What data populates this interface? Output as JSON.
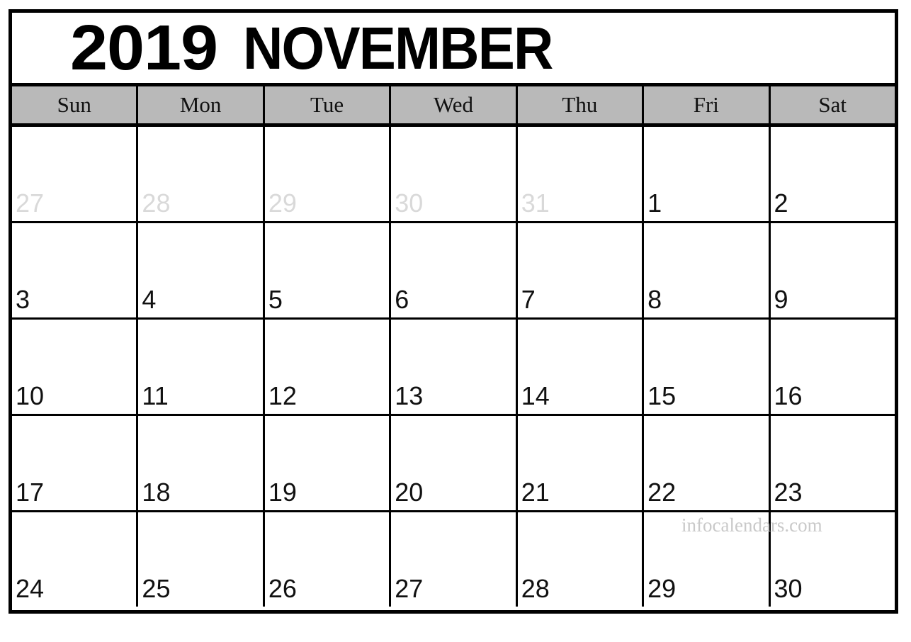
{
  "calendar": {
    "year": "2019",
    "month": "NOVEMBER",
    "weekdays": [
      {
        "label": "Sun"
      },
      {
        "label": "Mon"
      },
      {
        "label": "Tue"
      },
      {
        "label": "Wed"
      },
      {
        "label": "Thu"
      },
      {
        "label": "Fri"
      },
      {
        "label": "Sat"
      }
    ],
    "weeks": [
      [
        {
          "day": "27",
          "muted": true
        },
        {
          "day": "28",
          "muted": true
        },
        {
          "day": "29",
          "muted": true
        },
        {
          "day": "30",
          "muted": true
        },
        {
          "day": "31",
          "muted": true
        },
        {
          "day": "1",
          "muted": false
        },
        {
          "day": "2",
          "muted": false
        }
      ],
      [
        {
          "day": "3",
          "muted": false
        },
        {
          "day": "4",
          "muted": false
        },
        {
          "day": "5",
          "muted": false
        },
        {
          "day": "6",
          "muted": false
        },
        {
          "day": "7",
          "muted": false
        },
        {
          "day": "8",
          "muted": false
        },
        {
          "day": "9",
          "muted": false
        }
      ],
      [
        {
          "day": "10",
          "muted": false
        },
        {
          "day": "11",
          "muted": false
        },
        {
          "day": "12",
          "muted": false
        },
        {
          "day": "13",
          "muted": false
        },
        {
          "day": "14",
          "muted": false
        },
        {
          "day": "15",
          "muted": false
        },
        {
          "day": "16",
          "muted": false
        }
      ],
      [
        {
          "day": "17",
          "muted": false
        },
        {
          "day": "18",
          "muted": false
        },
        {
          "day": "19",
          "muted": false
        },
        {
          "day": "20",
          "muted": false
        },
        {
          "day": "21",
          "muted": false
        },
        {
          "day": "22",
          "muted": false
        },
        {
          "day": "23",
          "muted": false
        }
      ],
      [
        {
          "day": "24",
          "muted": false
        },
        {
          "day": "25",
          "muted": false
        },
        {
          "day": "26",
          "muted": false
        },
        {
          "day": "27",
          "muted": false
        },
        {
          "day": "28",
          "muted": false
        },
        {
          "day": "29",
          "muted": false
        },
        {
          "day": "30",
          "muted": false
        }
      ]
    ]
  },
  "watermark": {
    "text": "infocalendars.com"
  },
  "colors": {
    "border": "#000000",
    "weekday_band": "#b9b9b9",
    "day_text": "#111111",
    "muted_day_text": "#d9d9d9",
    "watermark_text": "#c9c9c9",
    "page_background": "#ffffff"
  }
}
